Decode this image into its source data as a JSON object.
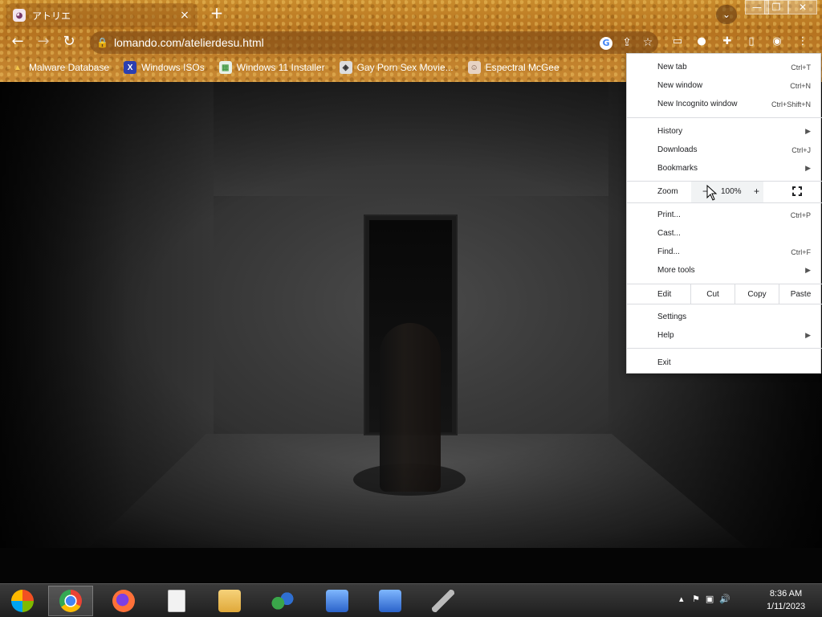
{
  "tab": {
    "title": "アトリエ",
    "close": "×"
  },
  "window": {
    "minimize": "—",
    "maximize": "❐",
    "close": "✕"
  },
  "toolbar": {
    "url": "lomando.com/atelierdesu.html"
  },
  "bookmarks": [
    {
      "label": "Malware Database",
      "icon": "bookmark-icon",
      "color": "#cfa02a"
    },
    {
      "label": "Windows ISOs",
      "icon": "x-icon",
      "color": "#2b3fb0"
    },
    {
      "label": "Windows 11 Installer",
      "icon": "image-icon",
      "color": "#4a9d4a"
    },
    {
      "label": "Gay Porn Sex Movie...",
      "icon": "globe-icon",
      "color": "#777777"
    },
    {
      "label": "Espectral McGee",
      "icon": "avatar-icon",
      "color": "#6b4a3a"
    }
  ],
  "menu": {
    "new_tab": {
      "label": "New tab",
      "shortcut": "Ctrl+T"
    },
    "new_window": {
      "label": "New window",
      "shortcut": "Ctrl+N"
    },
    "new_incognito": {
      "label": "New Incognito window",
      "shortcut": "Ctrl+Shift+N"
    },
    "history": {
      "label": "History"
    },
    "downloads": {
      "label": "Downloads",
      "shortcut": "Ctrl+J"
    },
    "bookmarks": {
      "label": "Bookmarks"
    },
    "zoom": {
      "label": "Zoom",
      "minus": "−",
      "value": "100%",
      "plus": "+"
    },
    "print": {
      "label": "Print...",
      "shortcut": "Ctrl+P"
    },
    "cast": {
      "label": "Cast..."
    },
    "find": {
      "label": "Find...",
      "shortcut": "Ctrl+F"
    },
    "more_tools": {
      "label": "More tools"
    },
    "edit": {
      "label": "Edit",
      "cut": "Cut",
      "copy": "Copy",
      "paste": "Paste"
    },
    "settings": {
      "label": "Settings"
    },
    "help": {
      "label": "Help"
    },
    "exit": {
      "label": "Exit"
    }
  },
  "taskbar": {
    "apps": [
      "start-orb",
      "chrome-icon",
      "firefox-icon",
      "notepad-icon",
      "file-explorer-icon",
      "network-icon",
      "remote-desktop-icon",
      "remote-desktop-icon",
      "tool-icon"
    ],
    "clock": {
      "time": "8:36 AM",
      "date": "1/11/2023"
    }
  }
}
